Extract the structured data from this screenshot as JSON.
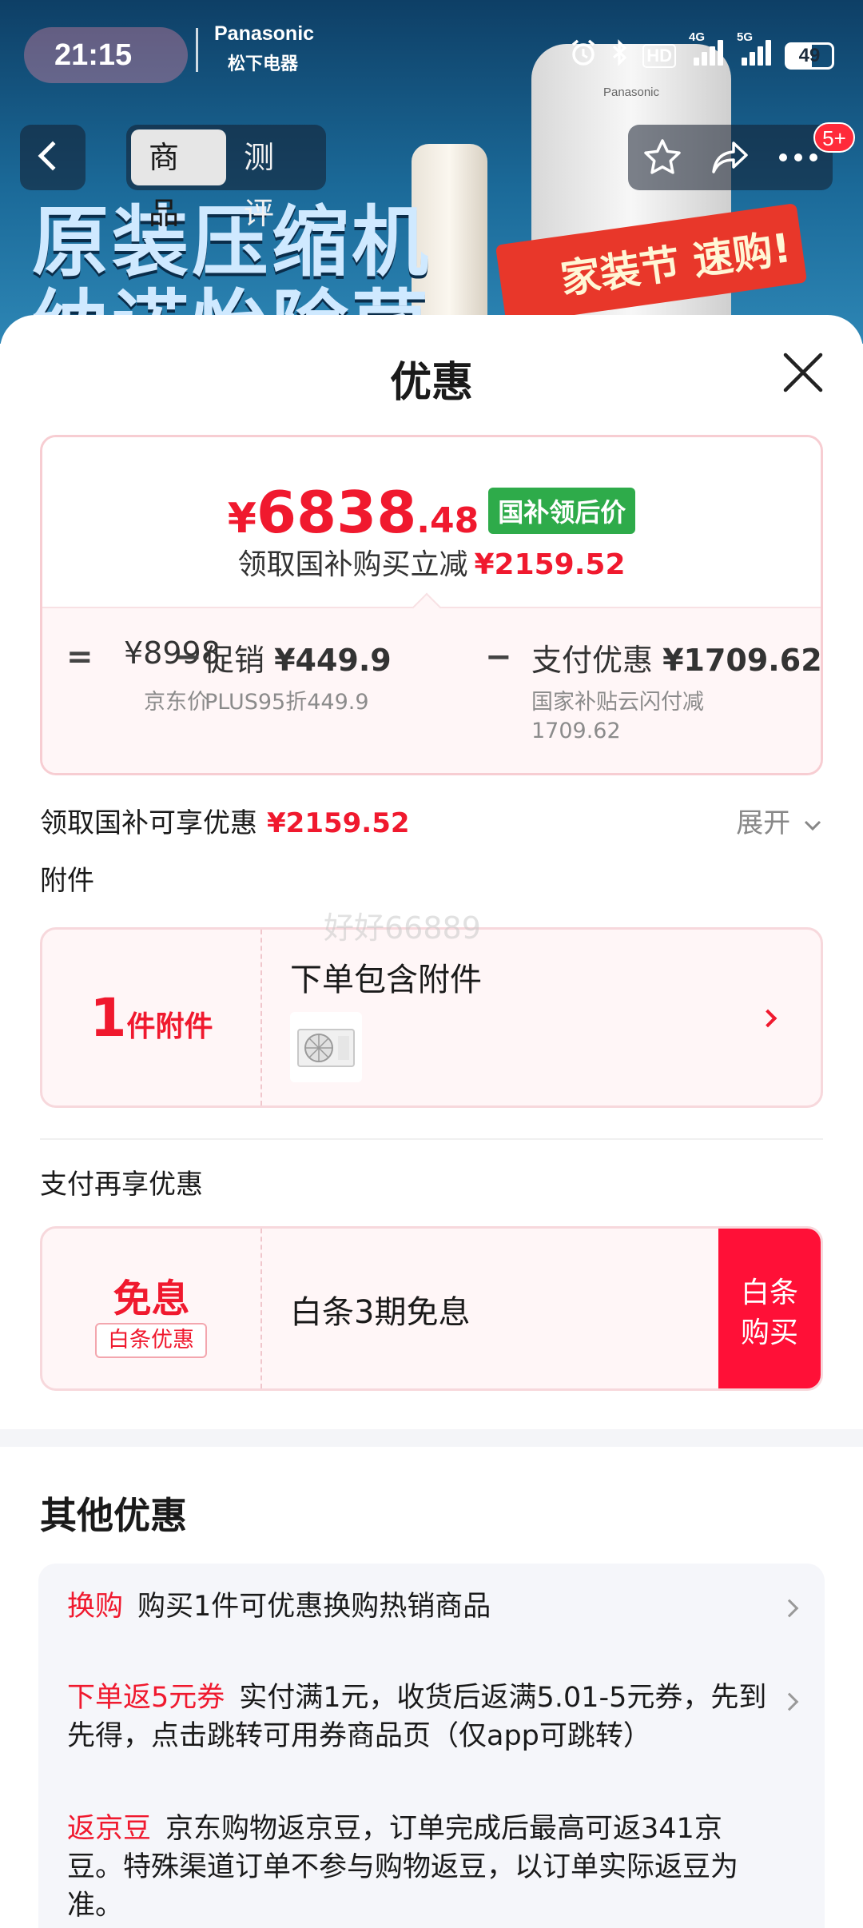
{
  "status_bar": {
    "time": "21:15",
    "brand": "Panasonic",
    "brand_cn": "松下电器",
    "hd": "HD",
    "net1": "4G",
    "net2": "5G",
    "battery": "49"
  },
  "banner": {
    "promo_line1": "原装压缩机",
    "promo_line2": "纳诺怡除菌",
    "promo_flag": "家装节 速购!",
    "product_brand": "Panasonic"
  },
  "nav": {
    "tabs": [
      {
        "label": "商品",
        "active": true
      },
      {
        "label": "测评",
        "active": false
      }
    ],
    "badge": "5+"
  },
  "sheet": {
    "title": "优惠"
  },
  "price_card": {
    "currency": "¥",
    "price_int": "6838",
    "price_dec": ".48",
    "subsidy_tag": "国补领后价",
    "sub_label": "领取国补购买立减",
    "sub_amount": "¥2159.52",
    "formula": {
      "equals": "=",
      "minus": "−",
      "item1_value": "¥8998",
      "item1_note": "京东价",
      "item2_label": "促销",
      "item2_value": "¥449.9",
      "item2_note": "PLUS95折449.9",
      "item3_label": "支付优惠",
      "item3_value": "¥1709.62",
      "item3_note_line1": "国家补贴云闪付减",
      "item3_note_line2": "1709.62"
    }
  },
  "subsidy_row": {
    "label": "领取国补可享优惠",
    "amount": "¥2159.52",
    "expand": "展开"
  },
  "attachment": {
    "section_label": "附件",
    "count": "1",
    "count_unit": "件附件",
    "title": "下单包含附件"
  },
  "payment": {
    "section_label": "支付再享优惠",
    "big": "免息",
    "tag": "白条优惠",
    "desc": "白条3期免息",
    "button_line1": "白条",
    "button_line2": "购买"
  },
  "other": {
    "title": "其他优惠",
    "items": [
      {
        "key": "换购",
        "text": "购买1件可优惠换购热销商品"
      },
      {
        "key": "下单返5元券",
        "text": "实付满1元，收货后返满5.01-5元券，先到先得，点击跳转可用券商品页（仅app可跳转）"
      },
      {
        "key": "返京豆",
        "text": "京东购物返京豆，订单完成后最高可返341京豆。特殊渠道订单不参与购物返豆，以订单实际返豆为准。"
      }
    ]
  },
  "watermark": "好好66889",
  "colors": {
    "accent_red": "#f0192e",
    "subsidy_green": "#2eab4a",
    "button_red": "#ff1037"
  }
}
